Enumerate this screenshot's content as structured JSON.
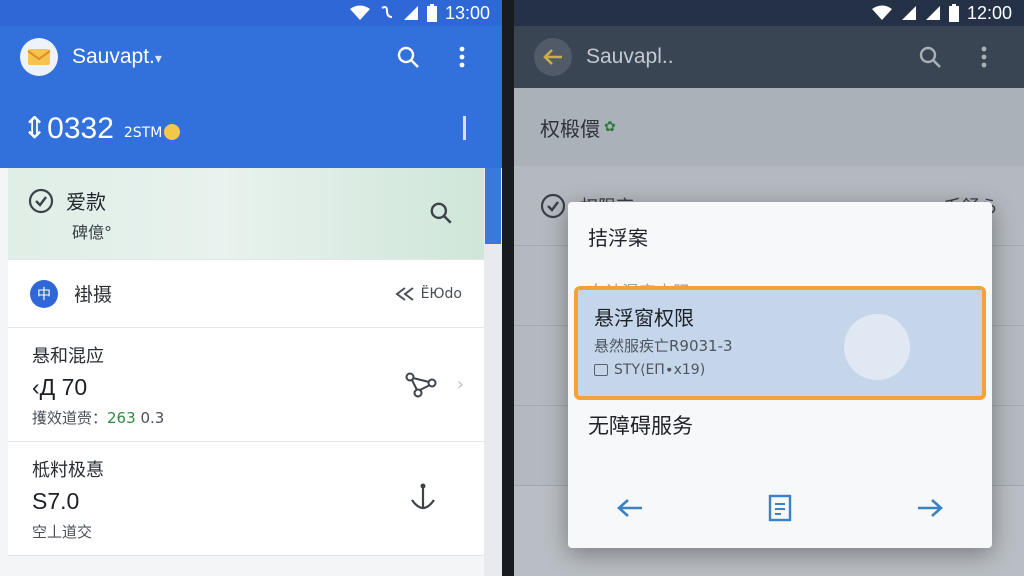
{
  "left": {
    "status": {
      "time": "13:00"
    },
    "appbar": {
      "title": "Sauvapt.",
      "dropdown": "▾"
    },
    "balance": {
      "value": "⇕0332",
      "sub": "2STM"
    },
    "hero": {
      "title": "爱款",
      "subtitle": "碑億°"
    },
    "row1": {
      "badge": "中",
      "label": "褂摄",
      "right": "ЁЮdо"
    },
    "card2": {
      "title": "悬和混应",
      "value": "‹Д 70",
      "foot_label": "擭效道赍：",
      "foot_num": "263",
      "foot_tail": "0.3"
    },
    "card3": {
      "title": "柢籿极惪",
      "value": "S7.0",
      "foot": "空丄道交"
    }
  },
  "right": {
    "status": {
      "time": "12:00"
    },
    "appbar": {
      "title": "Sauvapl.."
    },
    "header": {
      "title": "权椴儇",
      "dot": "✿"
    },
    "row1": {
      "label": "权限京",
      "right": "乇䤴ら"
    },
    "dialog": {
      "title": "拮浮案",
      "ghost": "白认混实内阻",
      "option": {
        "title": "悬浮窗权限",
        "subtitle": "悬然服疾亡R9031-3",
        "meta": "STY⟨ЕП∙х19)"
      },
      "item": "无障碍服务"
    }
  },
  "colors": {
    "primary": "#3270dc",
    "highlight": "#f2a23a",
    "accent_green": "#2e8b3f"
  }
}
